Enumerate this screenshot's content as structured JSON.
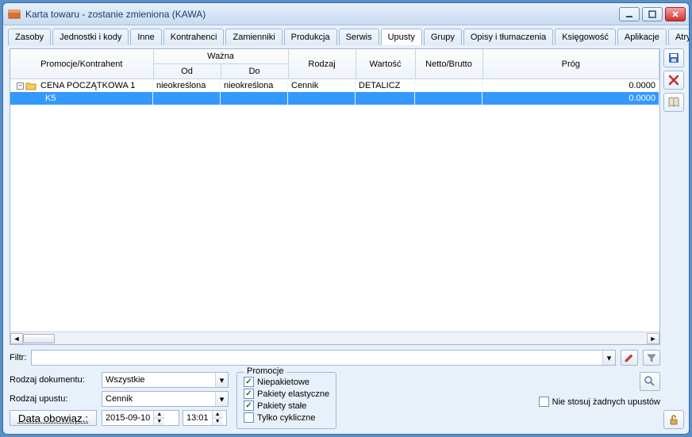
{
  "window": {
    "title": "Karta towaru - zostanie zmieniona (KAWA)"
  },
  "tabs": {
    "items": [
      "Zasoby",
      "Jednostki i kody",
      "Inne",
      "Kontrahenci",
      "Zamienniki",
      "Produkcja",
      "Serwis",
      "Upusty",
      "Grupy",
      "Opisy i tłumaczenia",
      "Księgowość",
      "Aplikacje",
      "Atrybuty"
    ],
    "active_index": 7
  },
  "grid": {
    "headers": {
      "promo": "Promocje/Kontrahent",
      "wazna": "Ważna",
      "od": "Od",
      "do": "Do",
      "rodzaj": "Rodzaj",
      "wartosc": "Wartość",
      "nettobrutto": "Netto/Brutto",
      "prog": "Próg"
    },
    "rows": [
      {
        "promo": "CENA POCZĄTKOWA 1",
        "od": "nieokreślona",
        "do": "nieokreślona",
        "rodzaj": "Cennik",
        "wartosc": "DETALICZ",
        "nettobrutto": "",
        "prog": "0.0000",
        "level": 0,
        "folder": true,
        "expanded": true,
        "selected": false
      },
      {
        "promo": "K5",
        "od": "",
        "do": "",
        "rodzaj": "",
        "wartosc": "",
        "nettobrutto": "",
        "prog": "0.0000",
        "level": 1,
        "folder": false,
        "expanded": false,
        "selected": true
      }
    ]
  },
  "filter": {
    "label": "Filtr:",
    "value": ""
  },
  "form": {
    "rodzaj_dok_label": "Rodzaj dokumentu:",
    "rodzaj_dok_value": "Wszystkie",
    "rodzaj_up_label": "Rodzaj upustu:",
    "rodzaj_up_value": "Cennik",
    "data_label": "Data obowiąz.:",
    "date": "2015-09-10",
    "time": "13:01"
  },
  "promocje_group": {
    "legend": "Promocje",
    "items": [
      {
        "label": "Niepakietowe",
        "checked": true
      },
      {
        "label": "Pakiety elastyczne",
        "checked": true
      },
      {
        "label": "Pakiety stałe",
        "checked": true
      },
      {
        "label": "Tylko cykliczne",
        "checked": false
      }
    ]
  },
  "nie_stosuj": {
    "label": "Nie stosuj żadnych upustów",
    "checked": false
  },
  "icons": {
    "save": "save-icon",
    "delete": "delete-icon",
    "book": "book-icon",
    "search": "search-icon",
    "unlock": "unlock-icon",
    "funnel": "funnel-icon",
    "pencil": "pencil-icon"
  }
}
